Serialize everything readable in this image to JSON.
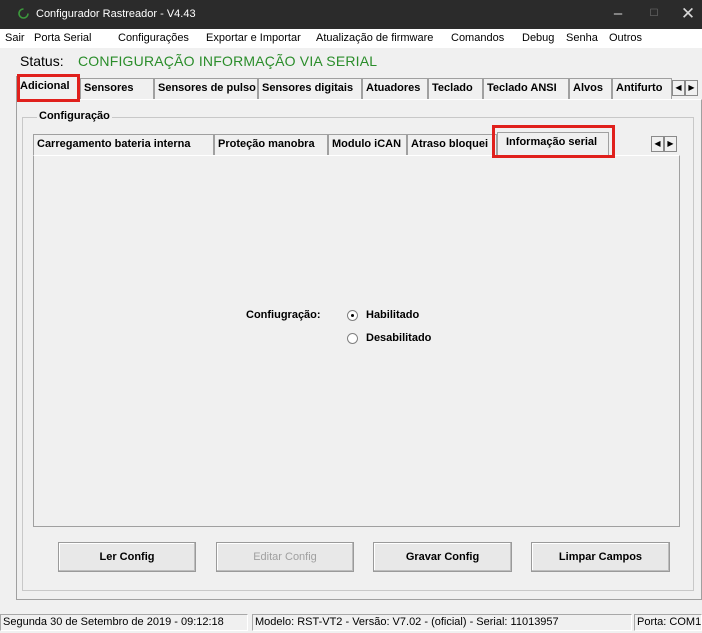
{
  "window": {
    "title": "Configurador Rastreador - V4.43"
  },
  "menu": [
    "Sair",
    "Porta Serial",
    "Configurações",
    "Exportar e Importar",
    "Atualização de firmware",
    "Comandos",
    "Debug",
    "Senha",
    "Outros"
  ],
  "status": {
    "label": "Status:",
    "value": "CONFIGURAÇÃO INFORMAÇÃO VIA SERIAL",
    "color": "#2a8d2a"
  },
  "main_tabs": [
    "Adicional",
    "Sensores",
    "Sensores de pulso",
    "Sensores digitais",
    "Atuadores",
    "Teclado",
    "Teclado ANSI",
    "Alvos",
    "Antifurto"
  ],
  "group": {
    "label": "Configuração"
  },
  "inner_tabs": [
    "Carregamento bateria interna",
    "Proteção manobra",
    "Modulo iCAN",
    "Atraso bloquei",
    "Informação serial"
  ],
  "form": {
    "label": "Confiugração:",
    "options": [
      "Habilitado",
      "Desabilitado"
    ],
    "selected": "Habilitado"
  },
  "buttons": {
    "read": "Ler Config",
    "edit": "Editar Config",
    "save": "Gravar Config",
    "clear": "Limpar Campos"
  },
  "statusbar": {
    "datetime": "Segunda 30 de Setembro de 2019  -  09:12:18",
    "model": "Modelo: RST-VT2  -  Versão: V7.02 - (oficial)  -  Serial: 11013957",
    "port": "Porta: COM1"
  },
  "highlight_color": "#e0201c"
}
